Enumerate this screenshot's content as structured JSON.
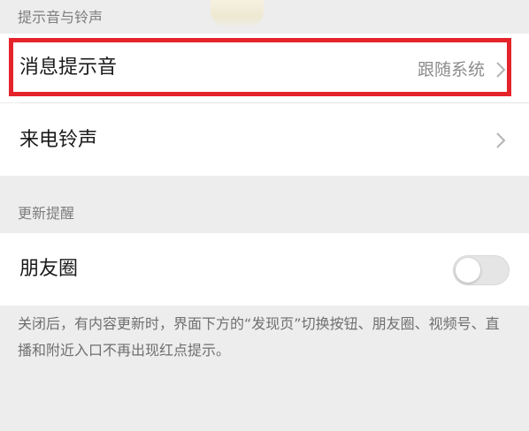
{
  "sections": {
    "notifications_header": "提示音与铃声",
    "update_header": "更新提醒"
  },
  "rows": {
    "message_tone": {
      "label": "消息提示音",
      "value": "跟随系统",
      "chevron_icon": "chevron-right-icon"
    },
    "ringtone": {
      "label": "来电铃声",
      "chevron_icon": "chevron-right-icon"
    },
    "moments": {
      "label": "朋友圈",
      "toggle_on": false
    }
  },
  "footnote": "关闭后，有内容更新时，界面下方的“发现页”切换按钮、朋友圈、视频号、直播和附近入口不再出现红点提示。",
  "colors": {
    "highlight": "#e5232b",
    "background": "#ededed",
    "row_background": "#ffffff"
  }
}
